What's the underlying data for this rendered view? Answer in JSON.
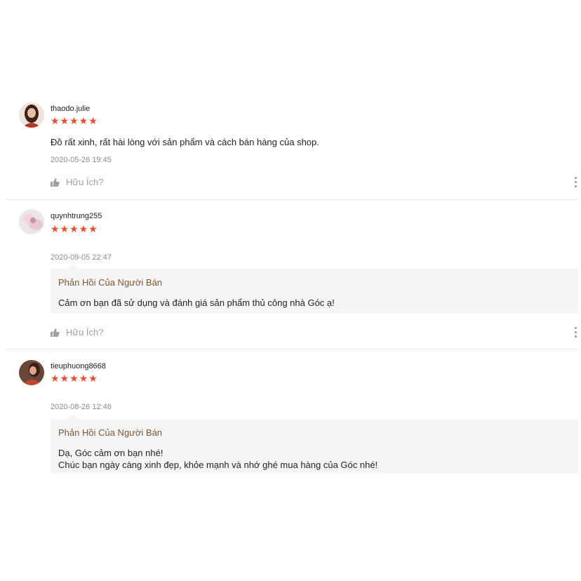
{
  "colors": {
    "star": "#ee4d2d",
    "reply_title": "#805534",
    "reply_bg": "#f5f5f5"
  },
  "icons": {
    "helpful": "thumbs-up-icon",
    "more": "more-vertical-icon"
  },
  "reviews": [
    {
      "username": "thaodo.julie",
      "stars": "★★★★★",
      "rating": 5,
      "comment": "Đồ rất xinh, rất hài lòng với sản phẩm và cách bán hàng của shop.",
      "time": "2020-05-26 19:45",
      "helpful": "Hữu Ích?"
    },
    {
      "username": "quynhtrung255",
      "stars": "★★★★★",
      "rating": 5,
      "time": "2020-09-05 22:47",
      "reply_title": "Phản Hồi Của Người Bán",
      "reply_lines": [
        "Cảm ơn bạn đã sử dụng và đánh giá sản phẩm thủ công nhà Góc ạ!"
      ],
      "helpful": "Hữu Ích?"
    },
    {
      "username": "tieuphuong8668",
      "stars": "★★★★★",
      "rating": 5,
      "time": "2020-08-26 12:46",
      "reply_title": "Phản Hồi Của Người Bán",
      "reply_lines": [
        "Dạ, Góc cảm ơn bạn nhé!",
        "Chúc bạn ngày càng xinh đẹp, khỏe mạnh và nhớ ghé mua hàng của Góc nhé!"
      ]
    }
  ]
}
